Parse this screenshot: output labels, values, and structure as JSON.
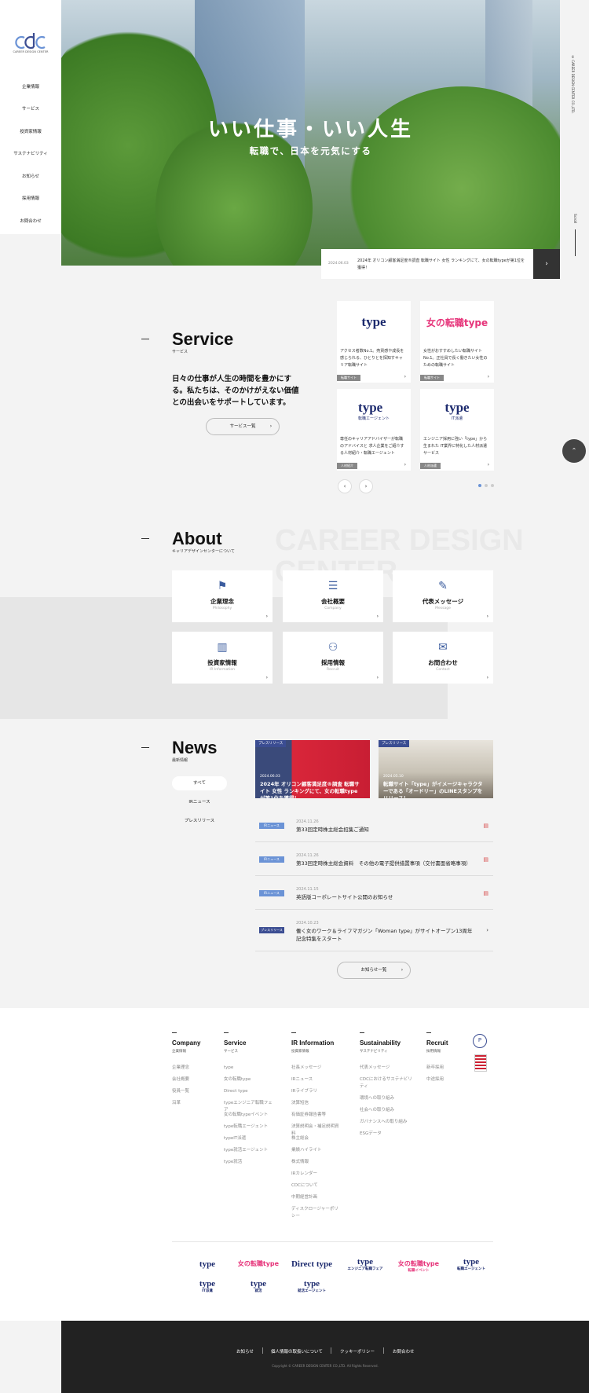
{
  "brand": {
    "logo_text": "CAREER DESIGN CENTER"
  },
  "nav": [
    "企業情報",
    "サービス",
    "投資家情報",
    "サステナビリティ",
    "お知らせ",
    "採用情報",
    "お問合わせ"
  ],
  "hero": {
    "title": "いい仕事・いい人生",
    "subtitle": "転職で、日本を元気にする",
    "copyright_vertical": "© CAREER DESIGN CENTER CO.,LTD.",
    "scroll_label": "Scroll"
  },
  "ticker": {
    "date": "2024.06.03",
    "text": "2024年 オリコン顧客満足度®調査 転職サイト 女性 ランキングにて、女の転職typeが第1位を獲得！"
  },
  "service": {
    "title": "Service",
    "subtitle": "サービス",
    "lead": "日々の仕事が人生の時間を豊かにする。私たちは、そのかけがえない価値との出会いをサポートしています。",
    "button": "サービス一覧",
    "cards": [
      {
        "logo": "type",
        "logo_sub": "",
        "desc": "アクセス者数No.1。売買感や成長を感じられる、ひとりとを探知すキャリア転職サイト",
        "tag": "転職サイト"
      },
      {
        "logo": "女の転職type",
        "logo_sub": "",
        "desc": "女性がおすすめしたい転職サイトNo.1。正社員で長く働きたい女性のための転職サイト",
        "tag": "転職サイト"
      },
      {
        "logo": "type",
        "logo_sub": "転職エージェント",
        "desc": "専任のキャリアアドバイザーが転職のアドバイスと 求人企業をご紹介する人材紹介・転職エージェント",
        "tag": "人材紹介"
      },
      {
        "logo": "type",
        "logo_sub": "IT派遣",
        "desc": "エンジニア採用に強い「type」から生まれた IT業界に特化した人材派遣サービス",
        "tag": "人材派遣"
      }
    ]
  },
  "about": {
    "title": "About",
    "subtitle": "キャリアデザインセンターについて",
    "watermark": "CAREER DESIGN CENTER",
    "cards": [
      {
        "title": "企業理念",
        "en": "Philosophy",
        "icon": "flag-icon"
      },
      {
        "title": "会社概要",
        "en": "Company",
        "icon": "list-icon"
      },
      {
        "title": "代表メッセージ",
        "en": "Message",
        "icon": "pen-icon"
      },
      {
        "title": "投資家情報",
        "en": "IR Information",
        "icon": "chart-icon"
      },
      {
        "title": "採用情報",
        "en": "Recruit",
        "icon": "people-icon"
      },
      {
        "title": "お問合わせ",
        "en": "Contact",
        "icon": "mail-icon"
      }
    ]
  },
  "news": {
    "title": "News",
    "subtitle": "最新情報",
    "filters": [
      "すべて",
      "IRニュース",
      "プレスリリース"
    ],
    "features": [
      {
        "tag": "プレスリリース",
        "date": "2024.06.03",
        "title": "2024年 オリコン顧客満足度®調査 転職サイト 女性 ランキングにて、女の転職typeが第1位を獲得！"
      },
      {
        "tag": "プレスリリース",
        "date": "2024.05.10",
        "title": "転職サイト「type」がイメージキャラクターである「オードリー」のLINEスタンプをリリース！"
      }
    ],
    "rows": [
      {
        "tag": "IRニュース",
        "date": "2024.11.26",
        "title": "第33回定時株主総会招集ご通知"
      },
      {
        "tag": "IRニュース",
        "date": "2024.11.26",
        "title": "第33回定時株主総会資料　その他の電子提供措置事項（交付書面省略事項）"
      },
      {
        "tag": "IRニュース",
        "date": "2024.11.15",
        "title": "英語版コーポレートサイト公開のお知らせ"
      },
      {
        "tag": "プレスリリース",
        "date": "2024.10.23",
        "title": "働く女のワーク＆ライフマガジン「Woman type」がサイトオープン13周年記念特集をスタート"
      }
    ],
    "button": "お知らせ一覧"
  },
  "footer": {
    "columns": [
      {
        "title": "Company",
        "sub": "企業情報",
        "links": [
          "企業理念",
          "会社概要",
          "役員一覧",
          "沿革"
        ]
      },
      {
        "title": "Service",
        "sub": "サービス",
        "links": [
          "type",
          "女の転職type",
          "Direct type",
          "typeエンジニア転職フェア",
          "女の転職typeイベント",
          "type転職エージェント",
          "typeIT派遣",
          "type就活エージェント",
          "type就活"
        ]
      },
      {
        "title": "IR Information",
        "sub": "投資家情報",
        "links": [
          "社長メッセージ",
          "IRニュース",
          "IRライブラリ",
          "決算短信",
          "有価証券報告書等",
          "決算説明会・補足説明資料",
          "株主総会",
          "業績ハイライト",
          "株式情報",
          "IRカレンダー",
          "CDCについて",
          "中期経営計画",
          "ディスクロージャーポリシー"
        ]
      },
      {
        "title": "Sustainability",
        "sub": "サステナビリティ",
        "links": [
          "代表メッセージ",
          "CDCにおけるサステナビリティ",
          "環境への取り組み",
          "社会への取り組み",
          "ガバナンスへの取り組み",
          "ESGデータ"
        ]
      },
      {
        "title": "Recruit",
        "sub": "採用情報",
        "links": [
          "新卒採用",
          "中途採用"
        ]
      }
    ],
    "brands": [
      {
        "name": "type",
        "sub": ""
      },
      {
        "name": "女の転職type",
        "sub": ""
      },
      {
        "name": "Direct type",
        "sub": ""
      },
      {
        "name": "type",
        "sub": "エンジニア転職フェア"
      },
      {
        "name": "女の転職type",
        "sub": "転職イベント"
      },
      {
        "name": "type",
        "sub": "転職エージェント"
      },
      {
        "name": "type",
        "sub": "IT派遣"
      },
      {
        "name": "type",
        "sub": "就活"
      },
      {
        "name": "type",
        "sub": "就活エージェント"
      }
    ],
    "bottom_links": [
      "お知らせ",
      "個人情報の取扱いについて",
      "クッキーポリシー",
      "お問合わせ"
    ],
    "copyright": "Copyright © CAREER DESIGN CENTER CO.,LTD. All Rights Reserved."
  },
  "colors": {
    "accent": "#3b4d92",
    "ir_tag": "#6b93d6",
    "pink": "#e6347a",
    "navy": "#1c2a6e"
  }
}
